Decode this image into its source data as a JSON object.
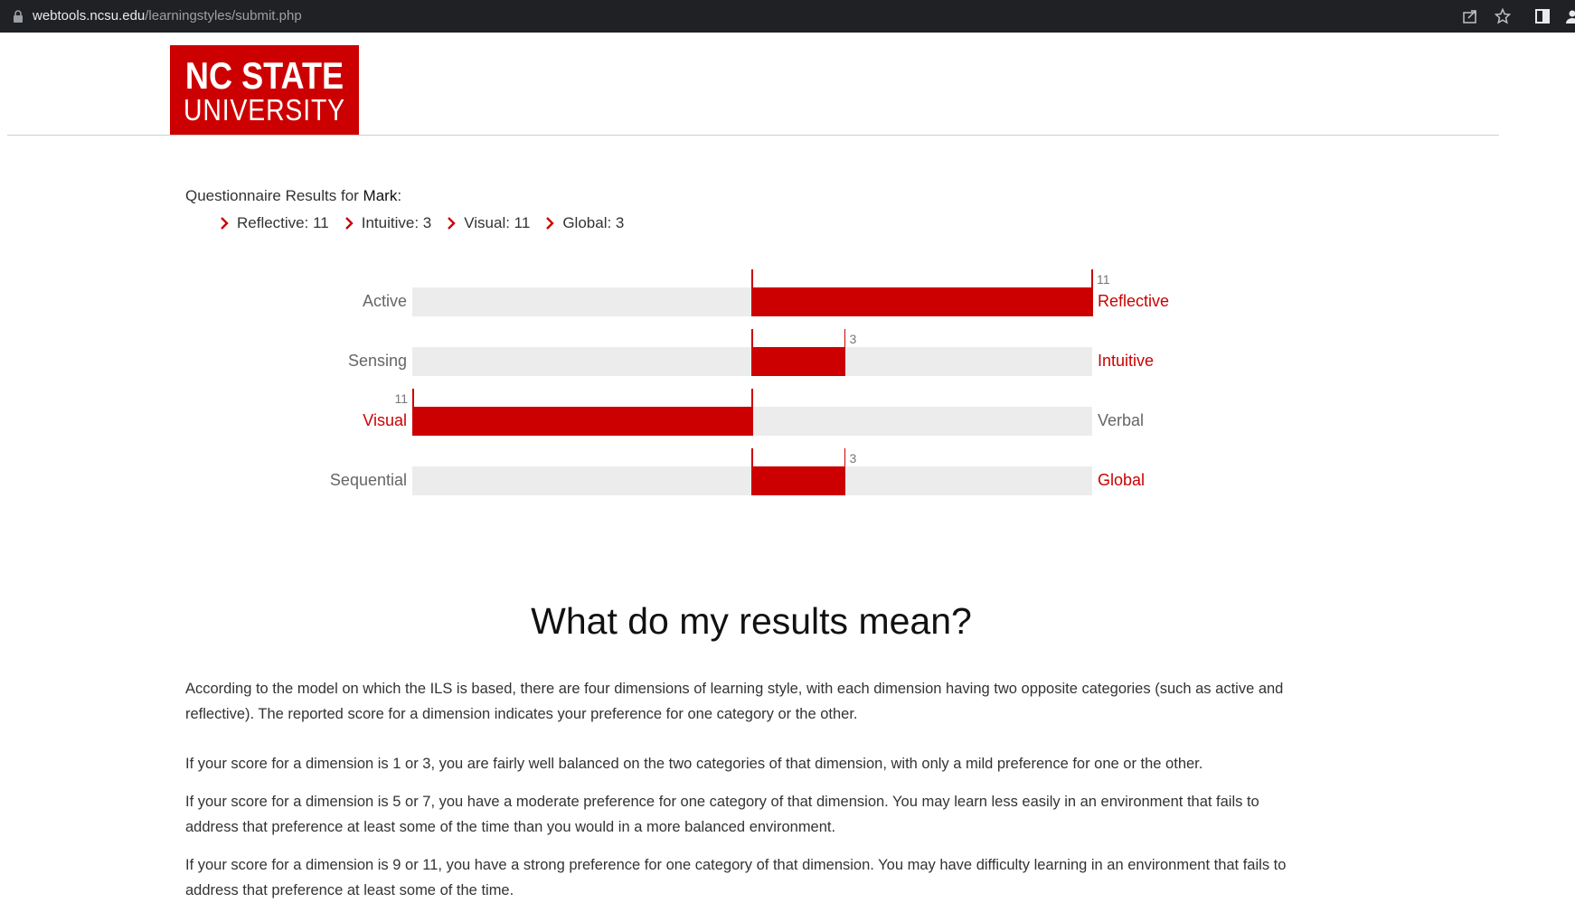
{
  "browser": {
    "url_host": "webtools.ncsu.edu",
    "url_path": "/learningstyles/submit.php",
    "icons": [
      "lock-icon",
      "share-icon",
      "star-icon",
      "sidebar-icon",
      "profile-icon"
    ]
  },
  "logo": {
    "line1": "NC STATE",
    "line2": "UNIVERSITY"
  },
  "results": {
    "title_prefix": "Questionnaire Results for ",
    "name": "Mark",
    "title_suffix": ":",
    "items": [
      {
        "label": "Reflective: 11"
      },
      {
        "label": "Intuitive: 3"
      },
      {
        "label": "Visual: 11"
      },
      {
        "label": "Global: 3"
      }
    ]
  },
  "chart_data": {
    "type": "bar",
    "orientation": "horizontal-diverging",
    "scale_max": 11,
    "dimensions": [
      {
        "left": "Active",
        "right": "Reflective",
        "score": 11,
        "side": "right"
      },
      {
        "left": "Sensing",
        "right": "Intuitive",
        "score": 3,
        "side": "right"
      },
      {
        "left": "Visual",
        "right": "Verbal",
        "score": 11,
        "side": "left"
      },
      {
        "left": "Sequential",
        "right": "Global",
        "score": 3,
        "side": "right"
      }
    ],
    "colors": {
      "bar": "#cc0000",
      "track": "#ececec",
      "active_label": "#cc0000",
      "inactive_label": "#666666"
    }
  },
  "explanation": {
    "heading": "What do my results mean?",
    "p1": "According to the model on which the ILS is based, there are four dimensions of learning style, with each dimension having two opposite categories (such as active and reflective). The reported score for a dimension indicates your preference for one category or the other.",
    "p2": "If your score for a dimension is 1 or 3, you are fairly well balanced on the two categories of that dimension, with only a mild preference for one or the other.",
    "p3": "If your score for a dimension is 5 or 7, you have a moderate preference for one category of that dimension. You may learn less easily in an environment that fails to address that preference at least some of the time than you would in a more balanced environment.",
    "p4": "If your score for a dimension is 9 or 11, you have a strong preference for one category of that dimension. You may have difficulty learning in an environment that fails to address that preference at least some of the time."
  }
}
